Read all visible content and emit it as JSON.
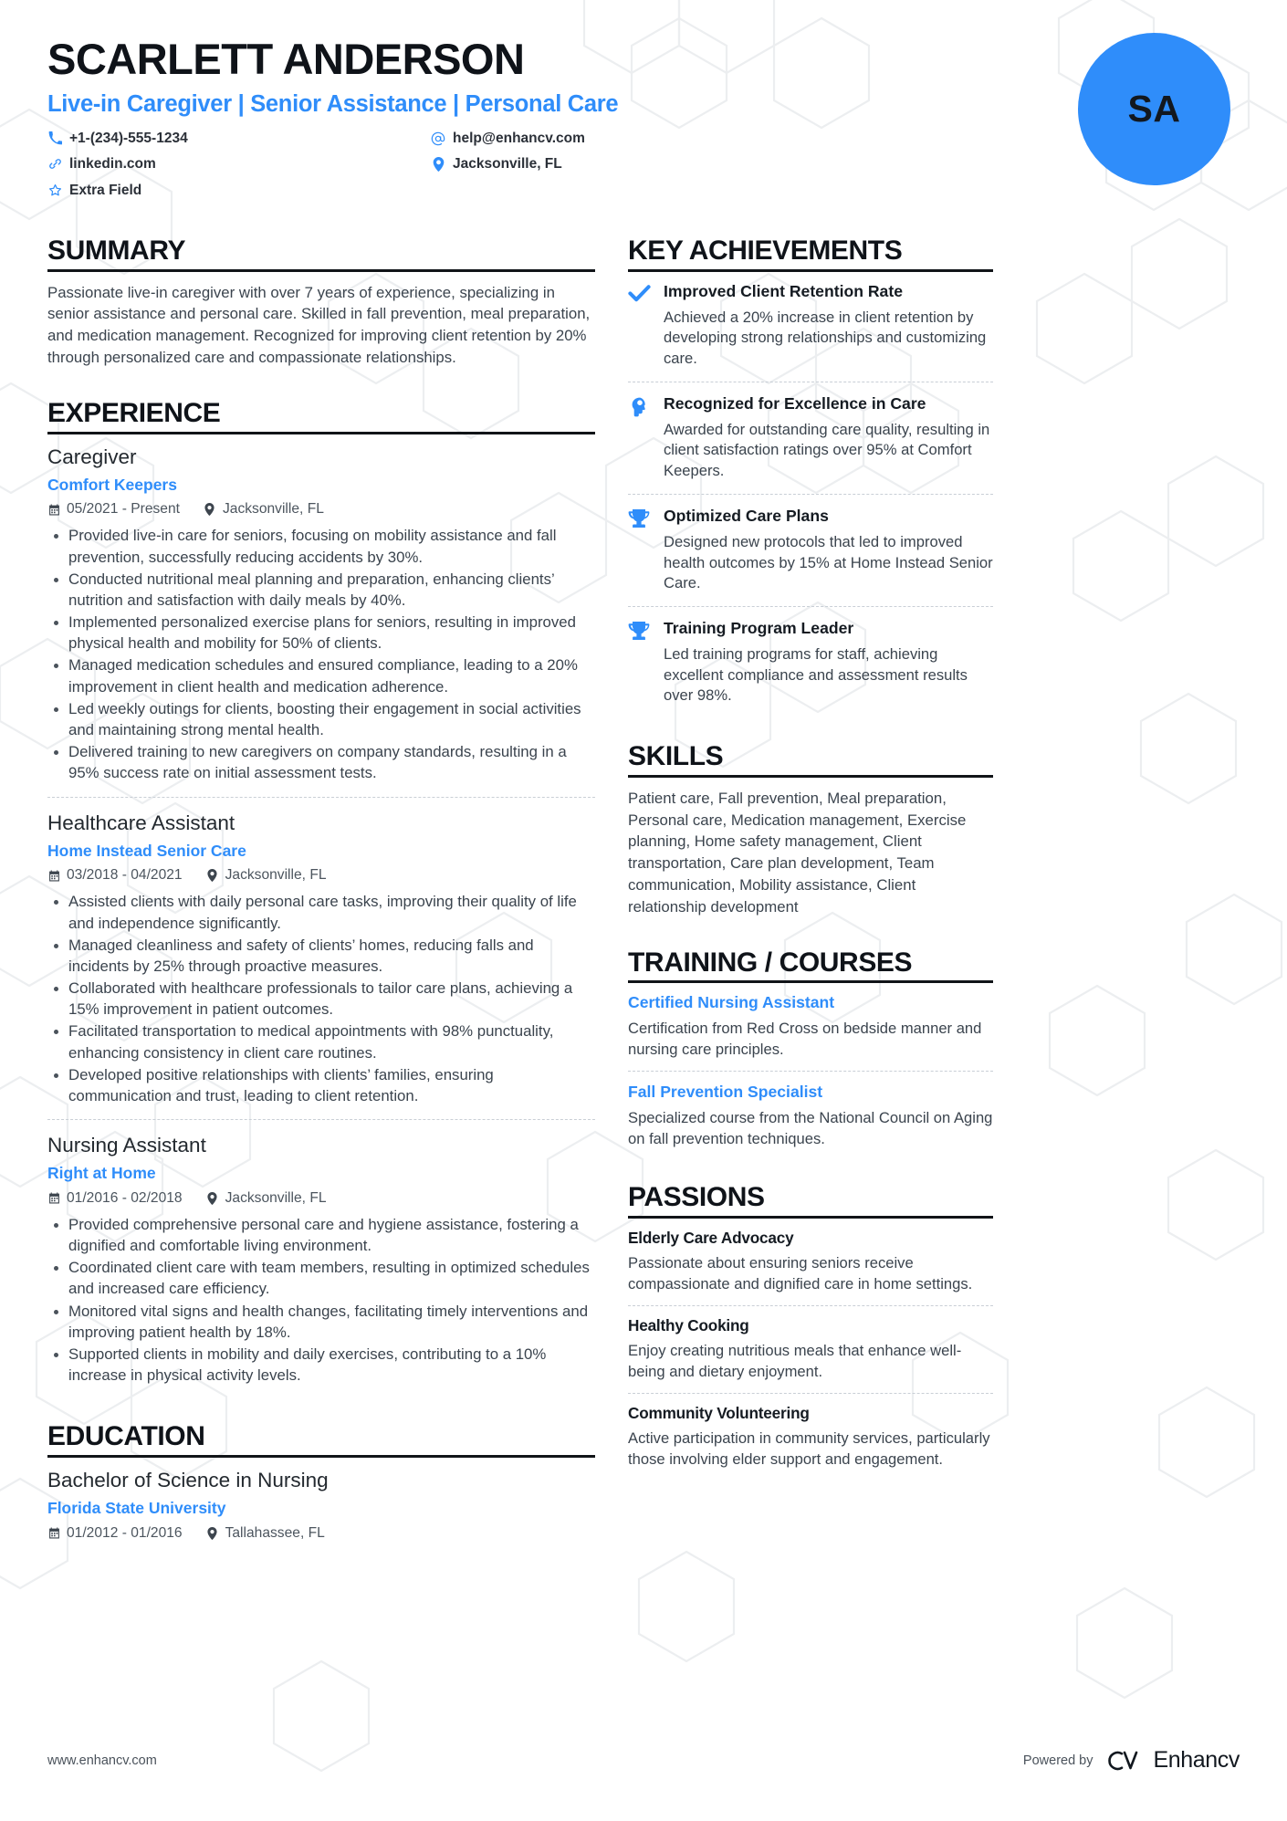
{
  "theme": {
    "accent": "#2f8dfa",
    "text": "#3b444e",
    "heading": "#0f1319",
    "divider": "#c9cfd6"
  },
  "header": {
    "name": "SCARLETT ANDERSON",
    "headline": "Live-in Caregiver | Senior Assistance | Personal Care",
    "avatar_initials": "SA",
    "contacts": [
      {
        "icon": "phone-icon",
        "value": "+1-(234)-555-1234"
      },
      {
        "icon": "at-icon",
        "value": "help@enhancv.com"
      },
      {
        "icon": "link-icon",
        "value": "linkedin.com"
      },
      {
        "icon": "location-icon",
        "value": "Jacksonville, FL"
      },
      {
        "icon": "star-icon",
        "value": "Extra Field"
      }
    ]
  },
  "summary": {
    "title": "SUMMARY",
    "text": "Passionate live-in caregiver with over 7 years of experience, specializing in senior assistance and personal care. Skilled in fall prevention, meal preparation, and medication management. Recognized for improving client retention by 20% through personalized care and compassionate relationships."
  },
  "experience": {
    "title": "EXPERIENCE",
    "jobs": [
      {
        "role": "Caregiver",
        "company": "Comfort Keepers",
        "dates": "05/2021 - Present",
        "location": "Jacksonville, FL",
        "bullets": [
          "Provided live-in care for seniors, focusing on mobility assistance and fall prevention, successfully reducing accidents by 30%.",
          "Conducted nutritional meal planning and preparation, enhancing clients’ nutrition and satisfaction with daily meals by 40%.",
          "Implemented personalized exercise plans for seniors, resulting in improved physical health and mobility for 50% of clients.",
          "Managed medication schedules and ensured compliance, leading to a 20% improvement in client health and medication adherence.",
          "Led weekly outings for clients, boosting their engagement in social activities and maintaining strong mental health.",
          "Delivered training to new caregivers on company standards, resulting in a 95% success rate on initial assessment tests."
        ]
      },
      {
        "role": "Healthcare Assistant",
        "company": "Home Instead Senior Care",
        "dates": "03/2018 - 04/2021",
        "location": "Jacksonville, FL",
        "bullets": [
          "Assisted clients with daily personal care tasks, improving their quality of life and independence significantly.",
          "Managed cleanliness and safety of clients’ homes, reducing falls and incidents by 25% through proactive measures.",
          "Collaborated with healthcare professionals to tailor care plans, achieving a 15% improvement in patient outcomes.",
          "Facilitated transportation to medical appointments with 98% punctuality, enhancing consistency in client care routines.",
          "Developed positive relationships with clients’ families, ensuring communication and trust, leading to client retention."
        ]
      },
      {
        "role": "Nursing Assistant",
        "company": "Right at Home",
        "dates": "01/2016 - 02/2018",
        "location": "Jacksonville, FL",
        "bullets": [
          "Provided comprehensive personal care and hygiene assistance, fostering a dignified and comfortable living environment.",
          "Coordinated client care with team members, resulting in optimized schedules and increased care efficiency.",
          "Monitored vital signs and health changes, facilitating timely interventions and improving patient health by 18%.",
          "Supported clients in mobility and daily exercises, contributing to a 10% increase in physical activity levels."
        ]
      }
    ]
  },
  "education": {
    "title": "EDUCATION",
    "entries": [
      {
        "degree": "Bachelor of Science in Nursing",
        "school": "Florida State University",
        "dates": "01/2012 - 01/2016",
        "location": "Tallahassee, FL"
      }
    ]
  },
  "key_achievements": {
    "title": "KEY ACHIEVEMENTS",
    "items": [
      {
        "icon": "check-icon",
        "title": "Improved Client Retention Rate",
        "desc": "Achieved a 20% increase in client retention by developing strong relationships and customizing care."
      },
      {
        "icon": "head-idea-icon",
        "title": "Recognized for Excellence in Care",
        "desc": "Awarded for outstanding care quality, resulting in client satisfaction ratings over 95% at Comfort Keepers."
      },
      {
        "icon": "trophy-icon",
        "title": "Optimized Care Plans",
        "desc": "Designed new protocols that led to improved health outcomes by 15% at Home Instead Senior Care."
      },
      {
        "icon": "trophy-icon",
        "title": "Training Program Leader",
        "desc": "Led training programs for staff, achieving excellent compliance and assessment results over 98%."
      }
    ]
  },
  "skills": {
    "title": "SKILLS",
    "text": "Patient care, Fall prevention, Meal preparation, Personal care, Medication management, Exercise planning, Home safety management, Client transportation, Care plan development, Team communication, Mobility assistance, Client relationship development"
  },
  "training": {
    "title": "TRAINING / COURSES",
    "items": [
      {
        "title": "Certified Nursing Assistant",
        "desc": "Certification from Red Cross on bedside manner and nursing care principles."
      },
      {
        "title": "Fall Prevention Specialist",
        "desc": "Specialized course from the National Council on Aging on fall prevention techniques."
      }
    ]
  },
  "passions": {
    "title": "PASSIONS",
    "items": [
      {
        "title": "Elderly Care Advocacy",
        "desc": "Passionate about ensuring seniors receive compassionate and dignified care in home settings."
      },
      {
        "title": "Healthy Cooking",
        "desc": "Enjoy creating nutritious meals that enhance well-being and dietary enjoyment."
      },
      {
        "title": "Community Volunteering",
        "desc": "Active participation in community services, particularly those involving elder support and engagement."
      }
    ]
  },
  "footer": {
    "url": "www.enhancv.com",
    "powered_by": "Powered by",
    "brand": "Enhancv"
  }
}
